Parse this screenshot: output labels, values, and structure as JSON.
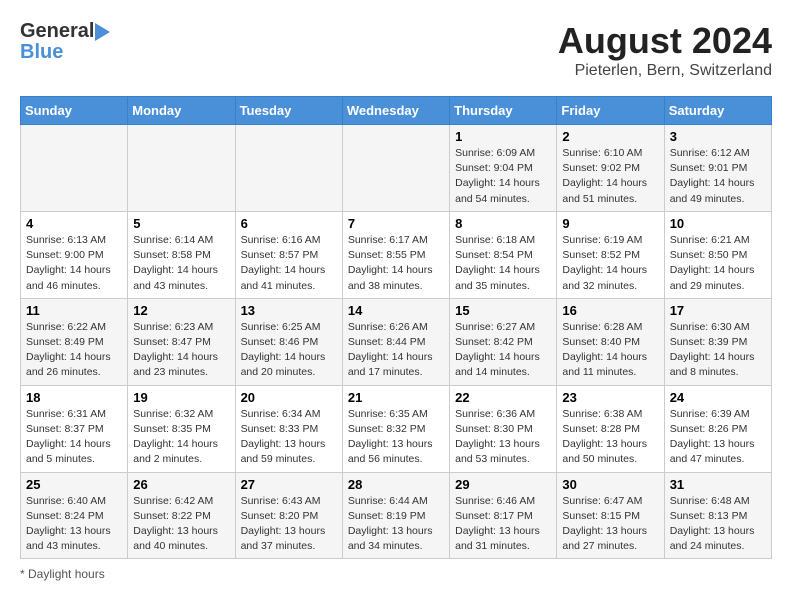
{
  "header": {
    "logo_general": "General",
    "logo_blue": "Blue",
    "month_year": "August 2024",
    "location": "Pieterlen, Bern, Switzerland"
  },
  "calendar": {
    "days_of_week": [
      "Sunday",
      "Monday",
      "Tuesday",
      "Wednesday",
      "Thursday",
      "Friday",
      "Saturday"
    ],
    "weeks": [
      [
        {
          "day": "",
          "info": ""
        },
        {
          "day": "",
          "info": ""
        },
        {
          "day": "",
          "info": ""
        },
        {
          "day": "",
          "info": ""
        },
        {
          "day": "1",
          "info": "Sunrise: 6:09 AM\nSunset: 9:04 PM\nDaylight: 14 hours\nand 54 minutes."
        },
        {
          "day": "2",
          "info": "Sunrise: 6:10 AM\nSunset: 9:02 PM\nDaylight: 14 hours\nand 51 minutes."
        },
        {
          "day": "3",
          "info": "Sunrise: 6:12 AM\nSunset: 9:01 PM\nDaylight: 14 hours\nand 49 minutes."
        }
      ],
      [
        {
          "day": "4",
          "info": "Sunrise: 6:13 AM\nSunset: 9:00 PM\nDaylight: 14 hours\nand 46 minutes."
        },
        {
          "day": "5",
          "info": "Sunrise: 6:14 AM\nSunset: 8:58 PM\nDaylight: 14 hours\nand 43 minutes."
        },
        {
          "day": "6",
          "info": "Sunrise: 6:16 AM\nSunset: 8:57 PM\nDaylight: 14 hours\nand 41 minutes."
        },
        {
          "day": "7",
          "info": "Sunrise: 6:17 AM\nSunset: 8:55 PM\nDaylight: 14 hours\nand 38 minutes."
        },
        {
          "day": "8",
          "info": "Sunrise: 6:18 AM\nSunset: 8:54 PM\nDaylight: 14 hours\nand 35 minutes."
        },
        {
          "day": "9",
          "info": "Sunrise: 6:19 AM\nSunset: 8:52 PM\nDaylight: 14 hours\nand 32 minutes."
        },
        {
          "day": "10",
          "info": "Sunrise: 6:21 AM\nSunset: 8:50 PM\nDaylight: 14 hours\nand 29 minutes."
        }
      ],
      [
        {
          "day": "11",
          "info": "Sunrise: 6:22 AM\nSunset: 8:49 PM\nDaylight: 14 hours\nand 26 minutes."
        },
        {
          "day": "12",
          "info": "Sunrise: 6:23 AM\nSunset: 8:47 PM\nDaylight: 14 hours\nand 23 minutes."
        },
        {
          "day": "13",
          "info": "Sunrise: 6:25 AM\nSunset: 8:46 PM\nDaylight: 14 hours\nand 20 minutes."
        },
        {
          "day": "14",
          "info": "Sunrise: 6:26 AM\nSunset: 8:44 PM\nDaylight: 14 hours\nand 17 minutes."
        },
        {
          "day": "15",
          "info": "Sunrise: 6:27 AM\nSunset: 8:42 PM\nDaylight: 14 hours\nand 14 minutes."
        },
        {
          "day": "16",
          "info": "Sunrise: 6:28 AM\nSunset: 8:40 PM\nDaylight: 14 hours\nand 11 minutes."
        },
        {
          "day": "17",
          "info": "Sunrise: 6:30 AM\nSunset: 8:39 PM\nDaylight: 14 hours\nand 8 minutes."
        }
      ],
      [
        {
          "day": "18",
          "info": "Sunrise: 6:31 AM\nSunset: 8:37 PM\nDaylight: 14 hours\nand 5 minutes."
        },
        {
          "day": "19",
          "info": "Sunrise: 6:32 AM\nSunset: 8:35 PM\nDaylight: 14 hours\nand 2 minutes."
        },
        {
          "day": "20",
          "info": "Sunrise: 6:34 AM\nSunset: 8:33 PM\nDaylight: 13 hours\nand 59 minutes."
        },
        {
          "day": "21",
          "info": "Sunrise: 6:35 AM\nSunset: 8:32 PM\nDaylight: 13 hours\nand 56 minutes."
        },
        {
          "day": "22",
          "info": "Sunrise: 6:36 AM\nSunset: 8:30 PM\nDaylight: 13 hours\nand 53 minutes."
        },
        {
          "day": "23",
          "info": "Sunrise: 6:38 AM\nSunset: 8:28 PM\nDaylight: 13 hours\nand 50 minutes."
        },
        {
          "day": "24",
          "info": "Sunrise: 6:39 AM\nSunset: 8:26 PM\nDaylight: 13 hours\nand 47 minutes."
        }
      ],
      [
        {
          "day": "25",
          "info": "Sunrise: 6:40 AM\nSunset: 8:24 PM\nDaylight: 13 hours\nand 43 minutes."
        },
        {
          "day": "26",
          "info": "Sunrise: 6:42 AM\nSunset: 8:22 PM\nDaylight: 13 hours\nand 40 minutes."
        },
        {
          "day": "27",
          "info": "Sunrise: 6:43 AM\nSunset: 8:20 PM\nDaylight: 13 hours\nand 37 minutes."
        },
        {
          "day": "28",
          "info": "Sunrise: 6:44 AM\nSunset: 8:19 PM\nDaylight: 13 hours\nand 34 minutes."
        },
        {
          "day": "29",
          "info": "Sunrise: 6:46 AM\nSunset: 8:17 PM\nDaylight: 13 hours\nand 31 minutes."
        },
        {
          "day": "30",
          "info": "Sunrise: 6:47 AM\nSunset: 8:15 PM\nDaylight: 13 hours\nand 27 minutes."
        },
        {
          "day": "31",
          "info": "Sunrise: 6:48 AM\nSunset: 8:13 PM\nDaylight: 13 hours\nand 24 minutes."
        }
      ]
    ]
  },
  "footer": {
    "note": "Daylight hours"
  }
}
